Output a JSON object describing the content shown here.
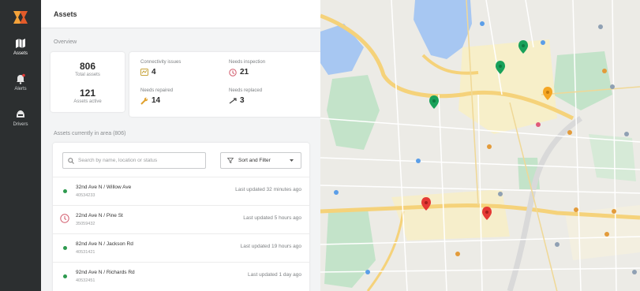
{
  "nav": {
    "items": [
      {
        "label": "Assets",
        "icon": "map-icon"
      },
      {
        "label": "Alerts",
        "icon": "bell-icon"
      },
      {
        "label": "Drivers",
        "icon": "helmet-icon"
      }
    ]
  },
  "panel": {
    "title": "Assets",
    "overview_label": "Overview",
    "total_assets": {
      "value": "806",
      "label": "Total assets"
    },
    "assets_active": {
      "value": "121",
      "label": "Assets active"
    },
    "stats": [
      {
        "label": "Connectivity issues",
        "value": "4",
        "icon": "signal-issue-icon"
      },
      {
        "label": "Needs inspection",
        "value": "21",
        "icon": "inspection-icon"
      },
      {
        "label": "Needs repaired",
        "value": "14",
        "icon": "wrench-icon"
      },
      {
        "label": "Needs replaced",
        "value": "3",
        "icon": "replace-icon"
      }
    ],
    "list_label": "Assets currently in area (806)",
    "search_placeholder": "Search by name, location or status",
    "sort_label": "Sort and Filter",
    "assets": [
      {
        "name": "32nd Ave N / Willow Ave",
        "id": "40534233",
        "updated": "Last updated 32 minutes ago",
        "status": "ok"
      },
      {
        "name": "22nd Ave N / Pine St",
        "id": "35059432",
        "updated": "Last updated 5 hours ago",
        "status": "alert"
      },
      {
        "name": "82nd Ave N / Jackson Rd",
        "id": "40531421",
        "updated": "Last updated 19 hours ago",
        "status": "ok"
      },
      {
        "name": "92nd Ave N / Richards Rd",
        "id": "40532451",
        "updated": "Last updated 1 day ago",
        "status": "ok"
      }
    ]
  },
  "colors": {
    "sidebar": "#2c2f30",
    "ok": "#2e9a4f",
    "alert": "#d25a6b",
    "pin_green": "#19a15a",
    "pin_red": "#e53935",
    "pin_orange": "#f5a623"
  }
}
